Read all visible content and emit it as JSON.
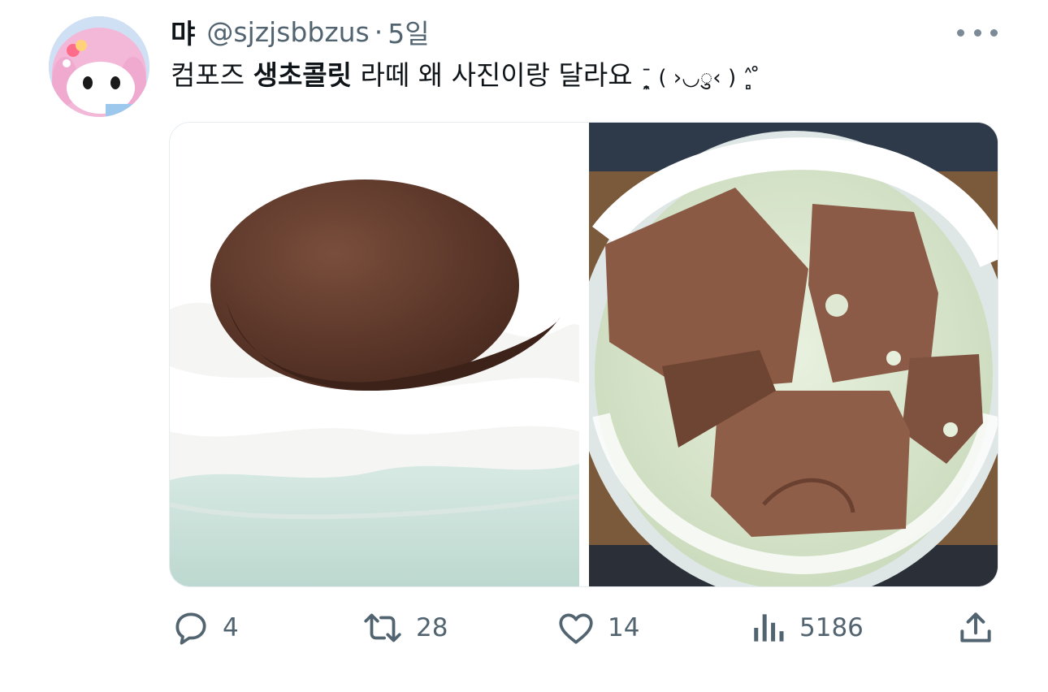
{
  "tweet": {
    "author_name": "먀",
    "handle": "@sjzjsbbzus",
    "separator": "·",
    "time": "5일",
    "text_before": "컴포즈 ",
    "text_bold": "생초콜릿",
    "text_after": " 라떼 왜 사진이랑 달라요 ",
    "emoticon": "ˉ̞̭ ( ›◡ु‹ ) ˄̻ ̊"
  },
  "actions": {
    "replies": "4",
    "retweets": "28",
    "likes": "14",
    "views": "5186"
  },
  "icons": {
    "more": "more-horizontal-icon",
    "reply": "reply-icon",
    "retweet": "retweet-icon",
    "like": "heart-icon",
    "views": "views-icon",
    "share": "share-icon"
  },
  "colors": {
    "text_primary": "#0f1419",
    "text_secondary": "#536471"
  }
}
